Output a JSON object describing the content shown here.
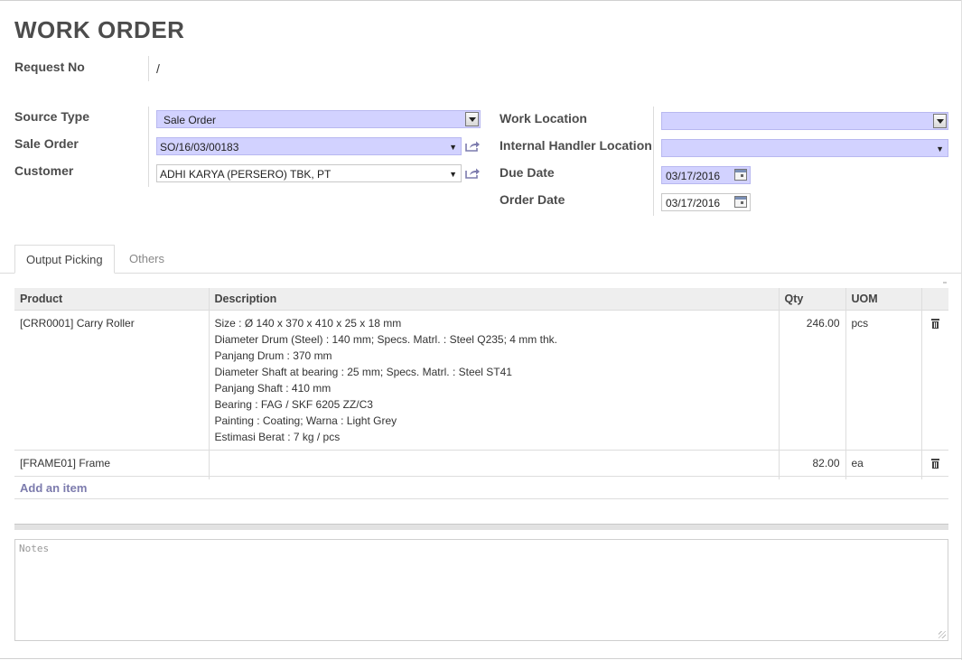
{
  "header": {
    "title": "WORK ORDER"
  },
  "request": {
    "label": "Request No",
    "value": "/"
  },
  "left_fields": {
    "source_type": {
      "label": "Source Type",
      "value": "Sale Order"
    },
    "sale_order": {
      "label": "Sale Order",
      "value": "SO/16/03/00183"
    },
    "customer": {
      "label": "Customer",
      "value": "ADHI KARYA (PERSERO) TBK, PT"
    }
  },
  "right_fields": {
    "work_location": {
      "label": "Work Location",
      "value": ""
    },
    "internal_handler_location": {
      "label": "Internal Handler Location",
      "value": ""
    },
    "due_date": {
      "label": "Due Date",
      "value": "03/17/2016"
    },
    "order_date": {
      "label": "Order Date",
      "value": "03/17/2016"
    }
  },
  "tabs": [
    {
      "label": "Output Picking",
      "active": true
    },
    {
      "label": "Others",
      "active": false
    }
  ],
  "table": {
    "columns": [
      "Product",
      "Description",
      "Qty",
      "UOM"
    ],
    "rows": [
      {
        "product": "[CRR0001] Carry Roller",
        "description": [
          "Size : Ø 140 x 370 x 410 x 25 x 18 mm",
          "Diameter Drum (Steel) : 140 mm; Specs. Matrl. : Steel Q235; 4 mm thk.",
          "Panjang Drum : 370 mm",
          "Diameter Shaft at bearing : 25 mm; Specs. Matrl. : Steel ST41",
          "Panjang Shaft : 410 mm",
          "Bearing : FAG / SKF 6205 ZZ/C3",
          "Painting : Coating; Warna : Light Grey",
          "Estimasi Berat : 7 kg / pcs"
        ],
        "qty": "246.00",
        "uom": "pcs"
      },
      {
        "product": "[FRAME01] Frame",
        "description": [],
        "qty": "82.00",
        "uom": "ea"
      }
    ],
    "add_item": "Add an item"
  },
  "notes": {
    "placeholder": "Notes"
  },
  "colors": {
    "required_bg": "#d2d2ff",
    "link": "#7c7bad"
  }
}
